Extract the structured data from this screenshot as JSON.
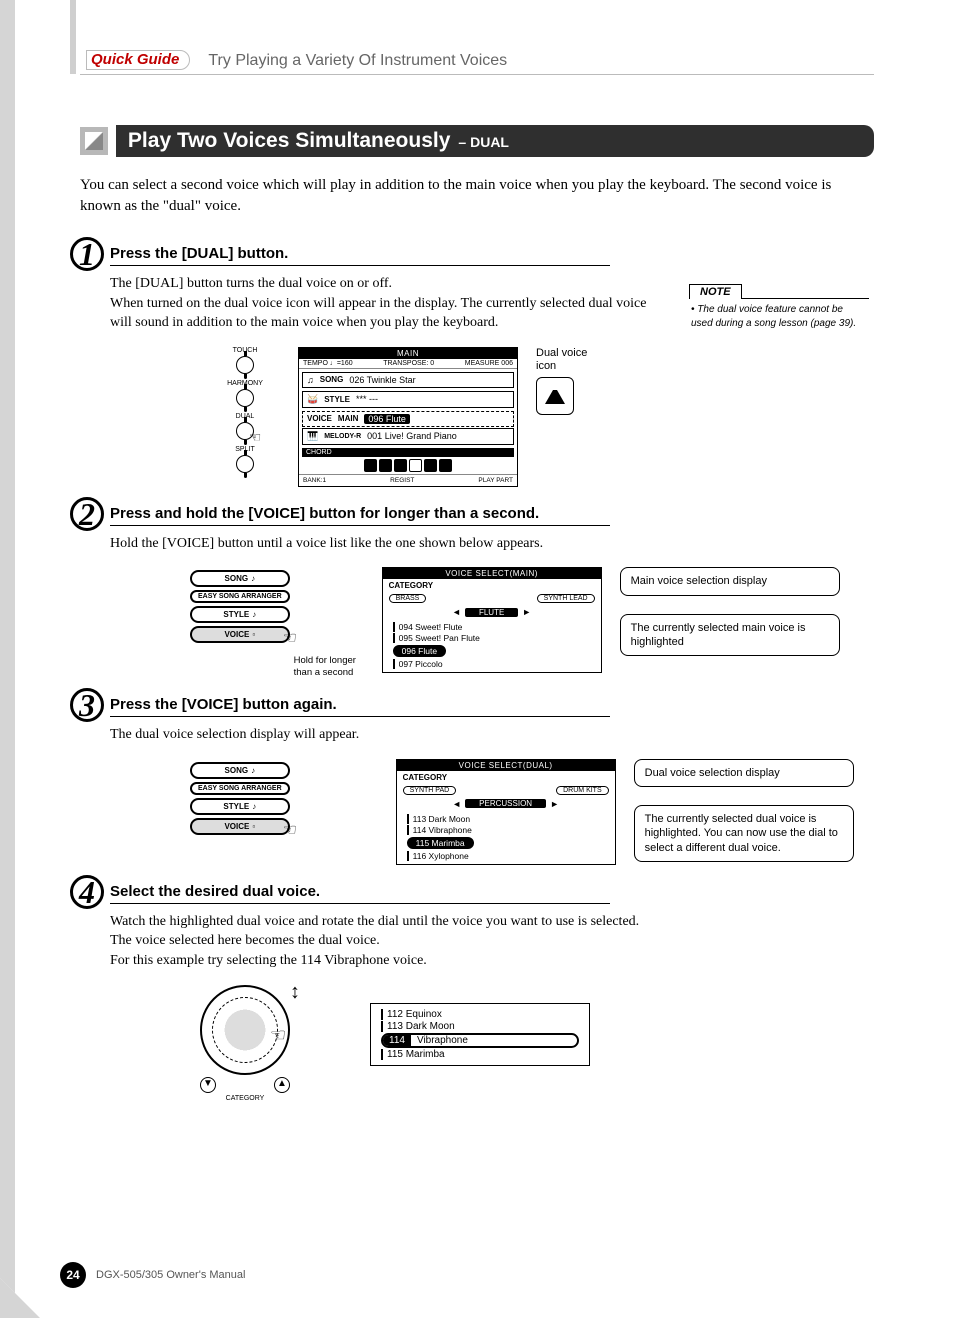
{
  "header": {
    "quickGuide": "Quick Guide",
    "title": "Try Playing a Variety Of Instrument Voices"
  },
  "section": {
    "title": "Play Two Voices Simultaneously",
    "subtitle": "– DUAL",
    "intro": "You can select a second voice which will play in addition to the main voice when you play the keyboard. The second voice is known as the \"dual\" voice."
  },
  "note": {
    "label": "NOTE",
    "text": "The dual voice feature cannot be used during a song lesson (page 39)."
  },
  "steps": {
    "s1": {
      "num": "1",
      "head": "Press the [DUAL] button.",
      "body": "The [DUAL] button turns the dual voice on or off.\nWhen turned on the dual voice icon will appear in the display. The currently selected dual voice will sound in addition to the main voice when you play the keyboard."
    },
    "s2": {
      "num": "2",
      "head": "Press and hold the [VOICE] button for longer than a second.",
      "body": "Hold the [VOICE] button until a voice list like the one shown below appears."
    },
    "s3": {
      "num": "3",
      "head": "Press the [VOICE] button again.",
      "body": "The dual voice selection display will appear."
    },
    "s4": {
      "num": "4",
      "head": "Select the desired dual voice.",
      "body": "Watch the highlighted dual voice and rotate the dial until the voice you want to use is selected. The voice selected here becomes the dual voice.\nFor this example try selecting the 114 Vibraphone voice."
    }
  },
  "knobs": {
    "k1": "TOUCH",
    "k2": "HARMONY",
    "k3": "DUAL",
    "k4": "SPLIT"
  },
  "lcd_main": {
    "title": "MAIN",
    "tempo": "TEMPO ♩=160",
    "transpose": "TRANSPOSE: 0",
    "measure": "MEASURE 006",
    "song_lab": "SONG",
    "song_val": "026 Twinkle Star",
    "style_lab": "STYLE",
    "style_val": "*** ---",
    "voice_lab": "VOICE",
    "main_lab": "MAIN",
    "main_val": "096 Flute",
    "melody_lab": "MELODY-R",
    "melody_val": "001 Live! Grand Piano",
    "chord": "CHORD",
    "bank": "BANK:1",
    "regist": "REGIST",
    "playpart": "PLAY PART"
  },
  "lcd_voicemain": {
    "title": "VOICE SELECT(MAIN)",
    "category": "CATEGORY",
    "cat_l": "BRASS",
    "cat_r": "SYNTH LEAD",
    "cat_sel": "FLUTE",
    "v1": "094  Sweet! Flute",
    "v2": "095  Sweet! Pan Flute",
    "v3": "096  Flute",
    "v4": "097  Piccolo"
  },
  "lcd_voicedual": {
    "title": "VOICE SELECT(DUAL)",
    "category": "CATEGORY",
    "cat_l": "SYNTH PAD",
    "cat_r": "DRUM KITS",
    "cat_sel": "PERCUSSION",
    "v1": "113  Dark Moon",
    "v2": "114  Vibraphone",
    "v3": "115  Marimba",
    "v4": "116  Xylophone"
  },
  "buttons": {
    "song": "SONG",
    "easy": "EASY SONG ARRANGER",
    "style": "STYLE",
    "voice": "VOICE"
  },
  "callouts": {
    "dualicon": "Dual voice icon",
    "c1": "Main voice selection display",
    "c2": "The currently selected main voice is highlighted",
    "c3": "Dual voice selection display",
    "c4": "The currently selected dual voice is highlighted. You can now use the dial to select a different dual voice."
  },
  "hint": "Hold for longer than a second",
  "dial_cat": "CATEGORY",
  "vlist_final": {
    "v0": "112  Equinox",
    "v1": "113  Dark Moon",
    "v2_num": "114",
    "v2_name": "Vibraphone",
    "v3": "115  Marimba"
  },
  "footer": {
    "page": "24",
    "model": "DGX-505/305  Owner's Manual"
  }
}
